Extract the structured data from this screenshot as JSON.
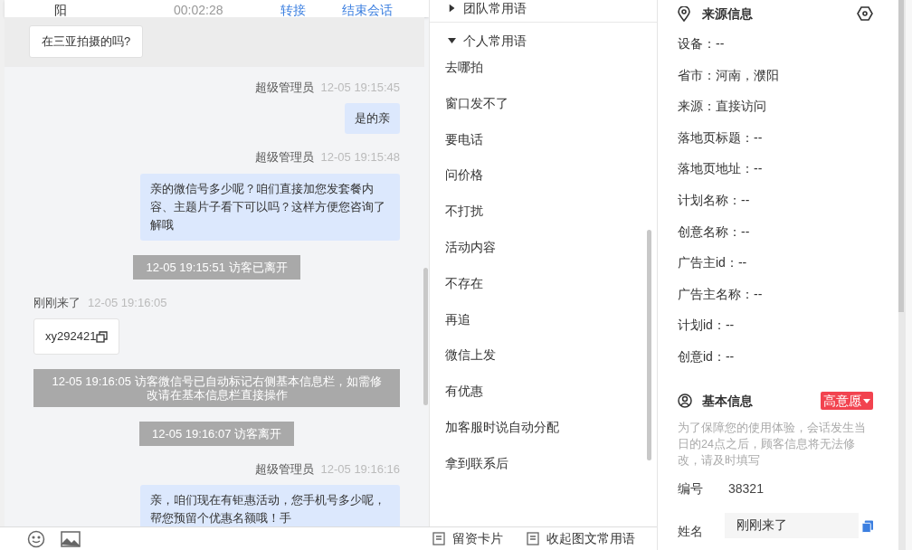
{
  "header": {
    "name": "阳",
    "duration": "00:02:28",
    "actions": [
      "转接",
      "结束会话"
    ]
  },
  "quote": {
    "text": "在三亚拍摄的吗?"
  },
  "messages": [
    {
      "kind": "agent",
      "sender": "超级管理员",
      "time": "12-05 19:15:45",
      "text": "是的亲"
    },
    {
      "kind": "agent",
      "sender": "超级管理员",
      "time": "12-05 19:15:48",
      "text": "亲的微信号多少呢？咱们直接加您发套餐内容、主题片子看下可以吗？这样方便您咨询了解哦"
    },
    {
      "kind": "system",
      "text": "12-05 19:15:51 访客已离开"
    },
    {
      "kind": "visitor",
      "sender": "刚刚来了",
      "time": "12-05 19:16:05",
      "text": "xy292421"
    },
    {
      "kind": "system",
      "text": "12-05 19:16:05 访客微信号已自动标记右侧基本信息栏，如需修改请在基本信息栏直接操作"
    },
    {
      "kind": "system",
      "text": "12-05 19:16:07 访客离开"
    },
    {
      "kind": "agent",
      "sender": "超级管理员",
      "time": "12-05 19:16:16",
      "text": "亲，咱们现在有钜惠活动，您手机号多少呢，帮您预留个优惠名额哦！手"
    }
  ],
  "toolbar": {
    "actions": [
      "留资卡片",
      "收起图文常用语"
    ]
  },
  "phrases": {
    "groups": [
      {
        "title": "团队常用语",
        "expanded": false
      },
      {
        "title": "个人常用语",
        "expanded": true,
        "items": [
          "去哪拍",
          "窗口发不了",
          "要电话",
          "问价格",
          "不打扰",
          "活动内容",
          "不存在",
          "再追",
          "微信上发",
          "有优惠",
          "加客服时说自动分配",
          "拿到联系后"
        ]
      }
    ]
  },
  "source_info": {
    "title": "来源信息",
    "fields": [
      "设备：--",
      "省市：河南，濮阳",
      "来源：直接访问",
      "落地页标题：--",
      "落地页地址：--",
      "计划名称：--",
      "创意名称：--",
      "广告主id：--",
      "广告主名称：--",
      "计划id：--",
      "创意id：--"
    ]
  },
  "basic_info": {
    "title": "基本信息",
    "intent": "高意愿",
    "notice": "为了保障您的使用体验，会话发生当日的24点之后，顾客信息将无法修改，请及时填写",
    "id_label": "编号",
    "id_value": "38321",
    "name_label": "姓名",
    "name_value": "刚刚来了"
  }
}
